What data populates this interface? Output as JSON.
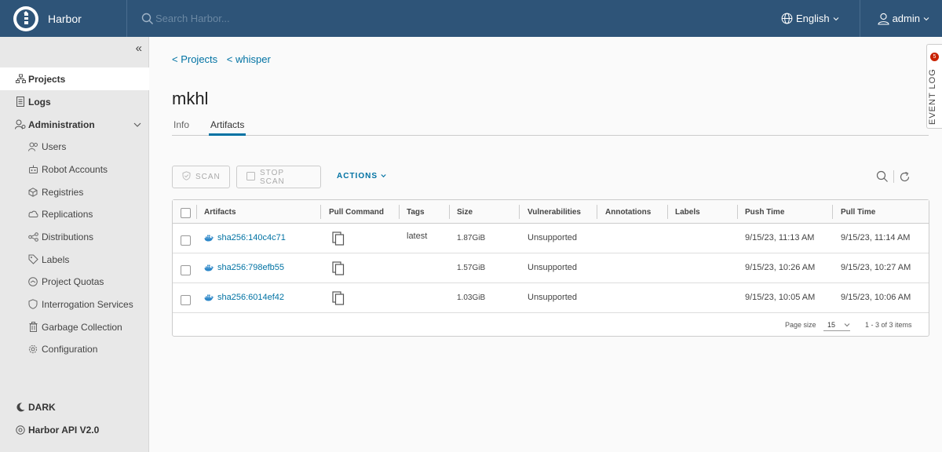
{
  "header": {
    "brand": "Harbor",
    "search_placeholder": "Search Harbor...",
    "language": "English",
    "user": "admin"
  },
  "sidebar": {
    "items": [
      {
        "label": "Projects",
        "icon": "projects-icon",
        "active": true
      },
      {
        "label": "Logs",
        "icon": "logs-icon"
      },
      {
        "label": "Administration",
        "icon": "administration-icon"
      }
    ],
    "admin_items": [
      {
        "label": "Users",
        "icon": "users-icon"
      },
      {
        "label": "Robot Accounts",
        "icon": "robot-icon"
      },
      {
        "label": "Registries",
        "icon": "registries-icon"
      },
      {
        "label": "Replications",
        "icon": "replications-icon"
      },
      {
        "label": "Distributions",
        "icon": "distributions-icon"
      },
      {
        "label": "Labels",
        "icon": "labels-icon"
      },
      {
        "label": "Project Quotas",
        "icon": "quotas-icon"
      },
      {
        "label": "Interrogation Services",
        "icon": "interrogation-icon"
      },
      {
        "label": "Garbage Collection",
        "icon": "garbage-icon"
      },
      {
        "label": "Configuration",
        "icon": "configuration-icon"
      }
    ],
    "theme": "DARK",
    "api": "Harbor API V2.0"
  },
  "breadcrumb": {
    "projects": "< Projects",
    "project": "< whisper"
  },
  "page_title": "mkhl",
  "tabs": [
    {
      "label": "Info"
    },
    {
      "label": "Artifacts",
      "active": true
    }
  ],
  "toolbar": {
    "scan": "SCAN",
    "stop_scan": "STOP SCAN",
    "actions": "ACTIONS"
  },
  "table": {
    "columns": [
      "Artifacts",
      "Pull Command",
      "Tags",
      "Size",
      "Vulnerabilities",
      "Annotations",
      "Labels",
      "Push Time",
      "Pull Time"
    ],
    "rows": [
      {
        "artifact": "sha256:140c4c71",
        "tags": "latest",
        "size": "1.87GiB",
        "vulnerabilities": "Unsupported",
        "push_time": "9/15/23, 11:13 AM",
        "pull_time": "9/15/23, 11:14 AM"
      },
      {
        "artifact": "sha256:798efb55",
        "tags": "",
        "size": "1.57GiB",
        "vulnerabilities": "Unsupported",
        "push_time": "9/15/23, 10:26 AM",
        "pull_time": "9/15/23, 10:27 AM"
      },
      {
        "artifact": "sha256:6014ef42",
        "tags": "",
        "size": "1.03GiB",
        "vulnerabilities": "Unsupported",
        "push_time": "9/15/23, 10:05 AM",
        "pull_time": "9/15/23, 10:06 AM"
      }
    ],
    "footer": {
      "page_size_label": "Page size",
      "page_size": "15",
      "item_count": "1 - 3 of 3 items"
    }
  },
  "event_log": {
    "label": "EVENT LOG",
    "badge": "5"
  },
  "colors": {
    "header": "#2e5478",
    "link": "#0072a3",
    "sidebar": "#e8e8e8"
  }
}
